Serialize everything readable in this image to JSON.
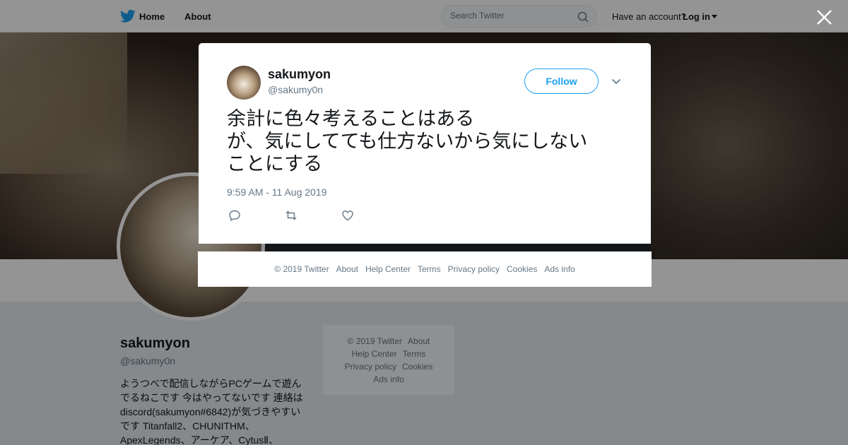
{
  "header": {
    "home_label": "Home",
    "about_label": "About",
    "search_placeholder": "Search Twitter",
    "have_account": "Have an account?",
    "login_label": "Log in"
  },
  "profile": {
    "name": "sakumyon",
    "handle": "@sakumy0n",
    "bio": "ようつべで配信しながらPCゲームで遊んでるねこです 今はやってないです 連絡はdiscord(sakumyon#6842)が気づきやすいです Titanfall2、CHUNITHM、ApexLegends、アーケア、CytusⅡ、"
  },
  "side_footer": {
    "items": [
      "© 2019 Twitter",
      "About",
      "Help Center",
      "Terms",
      "Privacy policy",
      "Cookies",
      "Ads info"
    ]
  },
  "tweet": {
    "author_name": "sakumyon",
    "author_handle": "@sakumy0n",
    "follow_label": "Follow",
    "text": "余計に色々考えることはある\nが、気にしてても仕方ないから気にしない\nことにする",
    "timestamp": "9:59 AM - 11 Aug 2019"
  },
  "modal_footer": {
    "items": [
      "© 2019 Twitter",
      "About",
      "Help Center",
      "Terms",
      "Privacy policy",
      "Cookies",
      "Ads info"
    ]
  },
  "colors": {
    "brand": "#1da1f2",
    "text": "#14171a",
    "muted": "#657786"
  },
  "icons": [
    "twitter-bird-icon",
    "search-icon",
    "caret-down-icon",
    "close-icon",
    "chevron-down-icon",
    "reply-icon",
    "retweet-icon",
    "like-icon"
  ]
}
